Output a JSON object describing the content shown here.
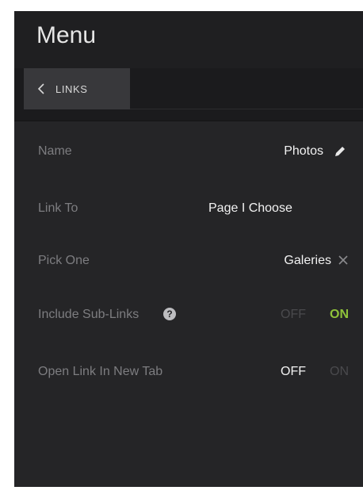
{
  "header": {
    "title": "Menu"
  },
  "tabbar": {
    "back_label": "LINKS",
    "back_icon": "chevron-left-icon"
  },
  "form": {
    "name": {
      "label": "Name",
      "value": "Photos",
      "icon": "pencil-icon"
    },
    "link_to": {
      "label": "Link To",
      "value": "Page I Choose"
    },
    "pick_one": {
      "label": "Pick One",
      "value": "Galeries",
      "icon": "close-icon"
    },
    "include_sub_links": {
      "label": "Include Sub-Links",
      "help_glyph": "?",
      "off": "OFF",
      "on": "ON",
      "state": "ON"
    },
    "open_new_tab": {
      "label": "Open Link In New Tab",
      "off": "OFF",
      "on": "ON",
      "state": "OFF"
    }
  },
  "colors": {
    "accent_on": "#8fc23a",
    "panel_bg": "#252527",
    "header_bg": "#1f1f21"
  }
}
